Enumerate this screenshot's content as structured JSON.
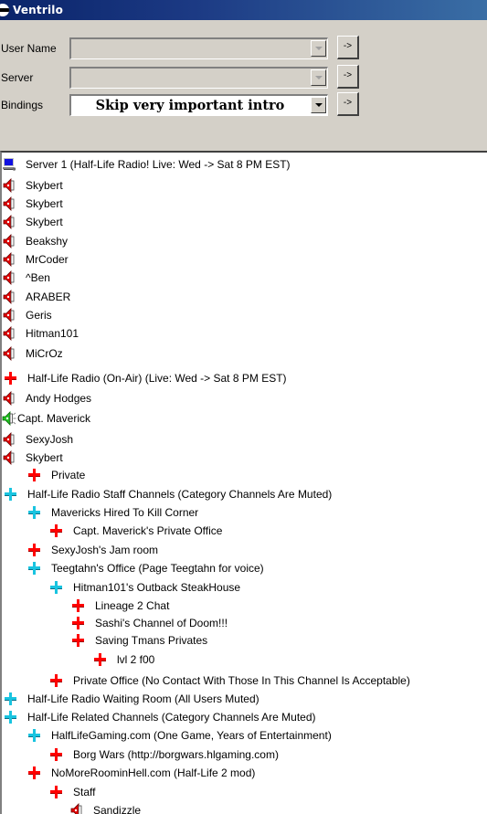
{
  "window": {
    "title": "Ventrilo",
    "icon": "ventrilo-logo-icon"
  },
  "form": {
    "user_name": {
      "label": "User Name",
      "value": "",
      "go_label": "->"
    },
    "server": {
      "label": "Server",
      "value": "",
      "go_label": "->"
    },
    "bindings": {
      "label": "Bindings",
      "value": "Skip very important intro",
      "go_label": "->"
    }
  },
  "tree": {
    "server_icon": "computer-icon",
    "items": [
      {
        "type": "server",
        "icon": "computer-icon",
        "depth": 0,
        "label": "Server 1 (Half-Life Radio! Live: Wed -> Sat 8 PM EST)"
      },
      {
        "type": "user",
        "icon": "speaker-icon",
        "depth": 0,
        "label": "Skybert"
      },
      {
        "type": "user",
        "icon": "speaker-icon",
        "depth": 0,
        "label": "Skybert"
      },
      {
        "type": "user",
        "icon": "speaker-icon",
        "depth": 0,
        "label": "Skybert"
      },
      {
        "type": "user",
        "icon": "speaker-icon",
        "depth": 0,
        "label": "Beakshy"
      },
      {
        "type": "user",
        "icon": "speaker-icon",
        "depth": 0,
        "label": "MrCoder"
      },
      {
        "type": "user",
        "icon": "speaker-icon",
        "depth": 0,
        "label": "^Ben"
      },
      {
        "type": "user",
        "icon": "speaker-icon",
        "depth": 0,
        "label": "ARABER"
      },
      {
        "type": "user",
        "icon": "speaker-icon",
        "depth": 0,
        "label": "Geris"
      },
      {
        "type": "user",
        "icon": "speaker-icon",
        "depth": 0,
        "label": "Hitman101"
      },
      {
        "type": "user",
        "icon": "speaker-icon",
        "depth": 0,
        "label": "MiCrOz"
      },
      {
        "type": "channel",
        "icon": "red-plus-icon",
        "depth": 0,
        "label": "Half-Life Radio (On-Air) (Live: Wed -> Sat 8 PM EST)"
      },
      {
        "type": "user",
        "icon": "speaker-icon",
        "depth": 0,
        "label": "Andy Hodges"
      },
      {
        "type": "user-talking",
        "icon": "speaker-talking-icon",
        "depth": 0,
        "label": "Capt. Maverick"
      },
      {
        "type": "user",
        "icon": "speaker-icon",
        "depth": 0,
        "label": "SexyJosh"
      },
      {
        "type": "user",
        "icon": "speaker-icon",
        "depth": 0,
        "label": "Skybert"
      },
      {
        "type": "channel",
        "icon": "red-plus-icon",
        "depth": 1,
        "label": "Private"
      },
      {
        "type": "category",
        "icon": "cyan-plus-icon",
        "depth": 0,
        "label": "Half-Life Radio Staff Channels (Category Channels Are Muted)"
      },
      {
        "type": "category",
        "icon": "cyan-plus-icon",
        "depth": 1,
        "label": "Mavericks Hired To Kill Corner"
      },
      {
        "type": "channel",
        "icon": "red-plus-icon",
        "depth": 2,
        "label": "Capt. Maverick's Private Office"
      },
      {
        "type": "channel",
        "icon": "red-plus-icon",
        "depth": 1,
        "label": "SexyJosh's Jam room"
      },
      {
        "type": "category",
        "icon": "cyan-plus-icon",
        "depth": 1,
        "label": "Teegtahn's Office (Page Teegtahn for voice)"
      },
      {
        "type": "category",
        "icon": "cyan-plus-icon",
        "depth": 2,
        "label": "Hitman101's Outback SteakHouse"
      },
      {
        "type": "channel",
        "icon": "red-plus-icon",
        "depth": 3,
        "label": "Lineage 2 Chat"
      },
      {
        "type": "channel",
        "icon": "red-plus-icon",
        "depth": 3,
        "label": "Sashi's Channel of Doom!!!"
      },
      {
        "type": "channel",
        "icon": "red-plus-icon",
        "depth": 3,
        "label": "Saving Tmans Privates"
      },
      {
        "type": "channel",
        "icon": "red-plus-icon",
        "depth": 4,
        "label": "lvl 2 f00"
      },
      {
        "type": "channel",
        "icon": "red-plus-icon",
        "depth": 2,
        "label": "Private Office (No Contact With Those In This Channel Is Acceptable)"
      },
      {
        "type": "category",
        "icon": "cyan-plus-icon",
        "depth": 0,
        "label": "Half-Life Radio Waiting Room (All Users Muted)"
      },
      {
        "type": "category",
        "icon": "cyan-plus-icon",
        "depth": 0,
        "label": "Half-Life Related Channels (Category Channels Are Muted)"
      },
      {
        "type": "category",
        "icon": "cyan-plus-icon",
        "depth": 1,
        "label": "HalfLifeGaming.com (One Game, Years of Entertainment)"
      },
      {
        "type": "channel",
        "icon": "red-plus-icon",
        "depth": 2,
        "label": "Borg Wars (http://borgwars.hlgaming.com)"
      },
      {
        "type": "channel",
        "icon": "red-plus-icon",
        "depth": 1,
        "label": "NoMoreRoominHell.com (Half-Life 2 mod)"
      },
      {
        "type": "channel",
        "icon": "red-plus-icon",
        "depth": 2,
        "label": "Staff"
      },
      {
        "type": "user",
        "icon": "speaker-icon",
        "depth": 3,
        "label": "Sandizzle"
      }
    ]
  },
  "colors": {
    "titlebar_start": "#0a246a",
    "titlebar_end": "#3a6ea5",
    "channel_plus": "#ff0000",
    "category_plus": "#19c4e0",
    "speaker_red": "#e00000",
    "speaker_green": "#20c020",
    "window_bg": "#d4d0c8"
  }
}
